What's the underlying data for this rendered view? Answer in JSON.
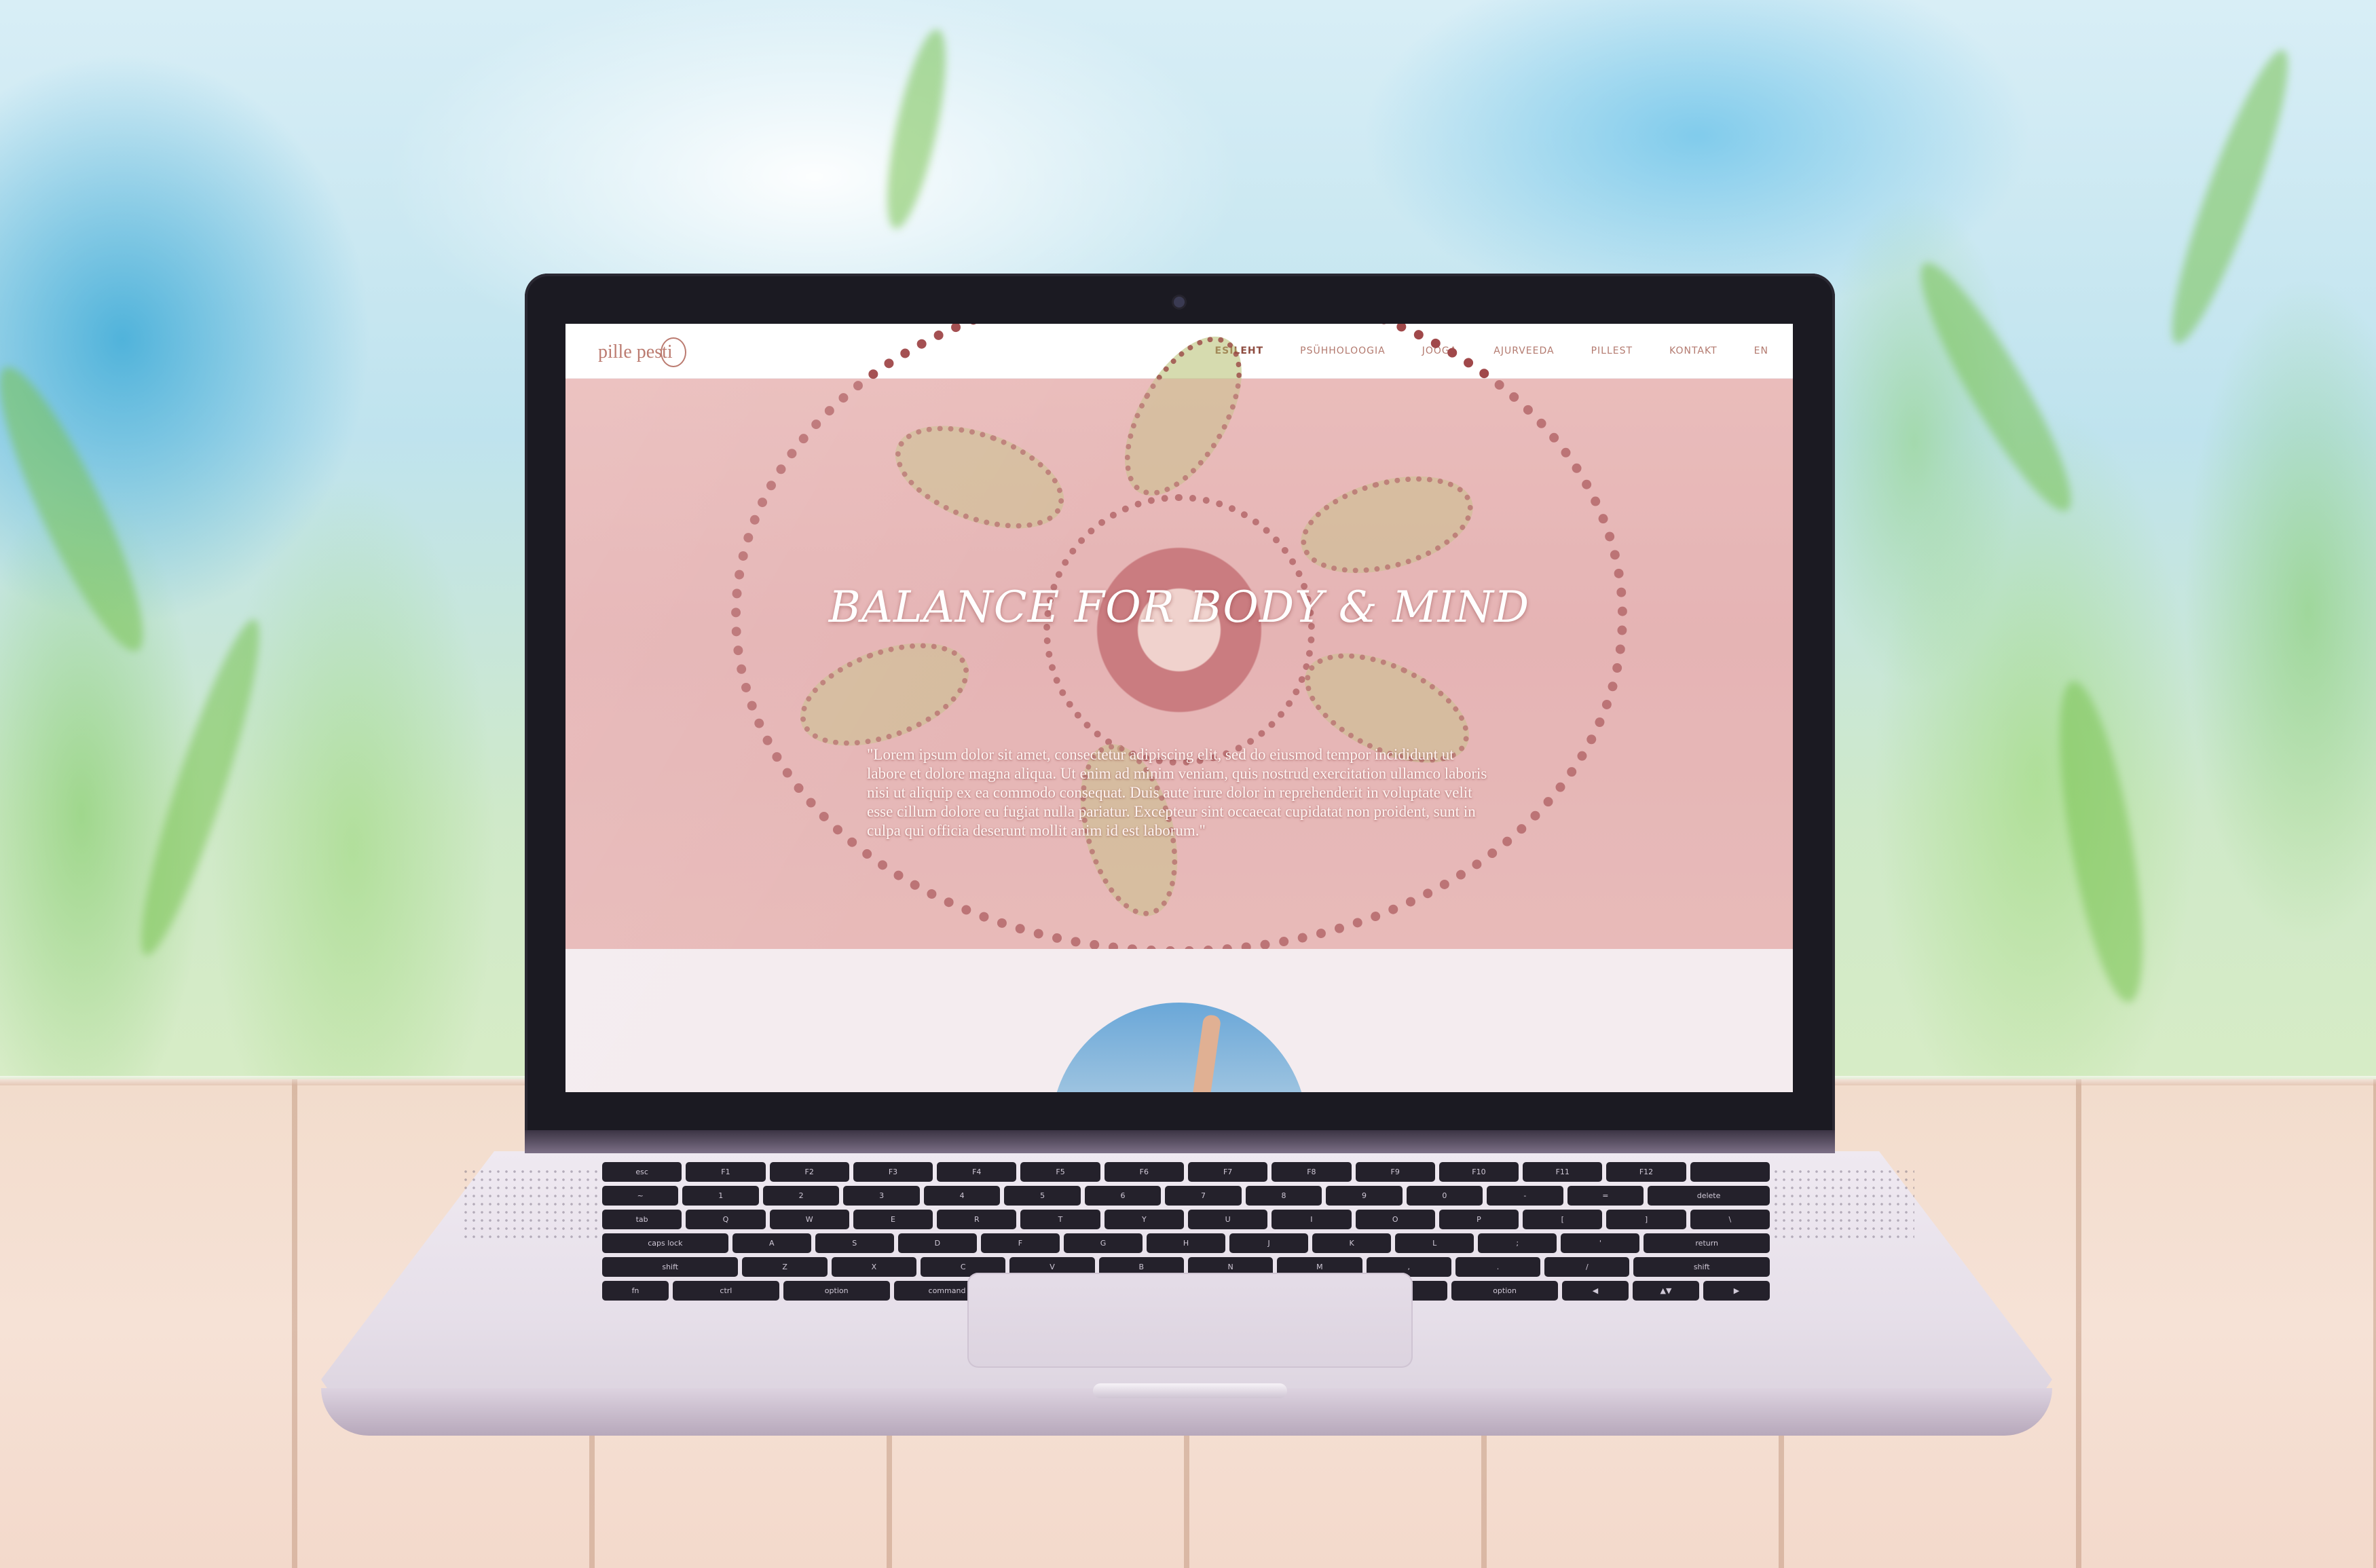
{
  "site": {
    "logo_text": "pille pesti",
    "nav": [
      {
        "label": "ESILEHT",
        "active": true
      },
      {
        "label": "PSÜHHOLOOGIA",
        "active": false
      },
      {
        "label": "JOOGA",
        "active": false
      },
      {
        "label": "AJURVEEDA",
        "active": false
      },
      {
        "label": "PILLEST",
        "active": false
      },
      {
        "label": "KONTAKT",
        "active": false
      },
      {
        "label": "EN",
        "active": false
      }
    ],
    "hero": {
      "title": "BALANCE FOR BODY & MIND",
      "quote": "\"Lorem ipsum dolor sit amet, consectetur adipiscing elit, sed do eiusmod tempor incididunt ut labore et dolore magna aliqua. Ut enim ad minim veniam, quis nostrud exercitation ullamco laboris nisi ut aliquip ex ea commodo consequat. Duis aute irure dolor in reprehenderit in voluptate velit esse cillum dolore eu fugiat nulla pariatur. Excepteur sint occaecat cupidatat non proident, sunt in culpa qui officia deserunt mollit anim id est laborum.\""
    }
  },
  "keyboard": {
    "rows": [
      [
        "esc",
        "F1",
        "F2",
        "F3",
        "F4",
        "F5",
        "F6",
        "F7",
        "F8",
        "F9",
        "F10",
        "F11",
        "F12",
        ""
      ],
      [
        "~",
        "1",
        "2",
        "3",
        "4",
        "5",
        "6",
        "7",
        "8",
        "9",
        "0",
        "-",
        "=",
        "delete"
      ],
      [
        "tab",
        "Q",
        "W",
        "E",
        "R",
        "T",
        "Y",
        "U",
        "I",
        "O",
        "P",
        "[",
        "]",
        "\\"
      ],
      [
        "caps lock",
        "A",
        "S",
        "D",
        "F",
        "G",
        "H",
        "J",
        "K",
        "L",
        ";",
        "'",
        "return"
      ],
      [
        "shift",
        "Z",
        "X",
        "C",
        "V",
        "B",
        "N",
        "M",
        ",",
        ".",
        "/",
        "shift"
      ],
      [
        "fn",
        "ctrl",
        "option",
        "command",
        "",
        "command",
        "option",
        "◀",
        "▲▼",
        "▶"
      ]
    ]
  }
}
